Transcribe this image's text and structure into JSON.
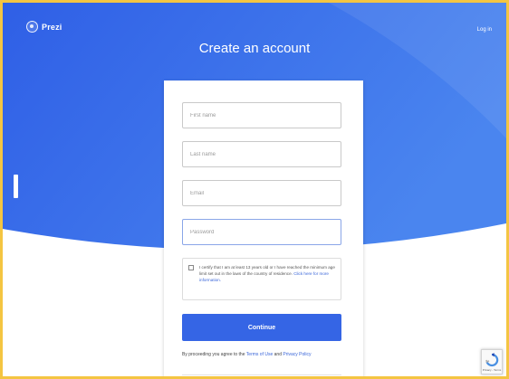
{
  "header": {
    "logo_text": "Prezi",
    "login_link": "Log in"
  },
  "page": {
    "title": "Create an account"
  },
  "form": {
    "first_name_placeholder": "First name",
    "last_name_placeholder": "Last name",
    "email_placeholder": "Email",
    "password_placeholder": "Password",
    "consent_text": "I certify that I am at least 13 years old or I have reached the minimum age limit set out in the laws of the country of residence.",
    "consent_link": "Click here for more information.",
    "continue_label": "Continue",
    "terms_prefix": "By proceeding you agree to the ",
    "terms_link": "Terms of Use",
    "terms_mid": " and ",
    "privacy_link": "Privacy Policy"
  },
  "recaptcha": {
    "label": "Privacy - Terms"
  },
  "colors": {
    "hero_blue": "#3767ea",
    "hero_blue_light": "#4f86ee",
    "button_blue": "#3565e5",
    "link_blue": "#3a66d9",
    "frame_border": "#f4c542"
  },
  "icons": {
    "logo": "prezi-logo-icon",
    "recaptcha": "recaptcha-icon"
  }
}
